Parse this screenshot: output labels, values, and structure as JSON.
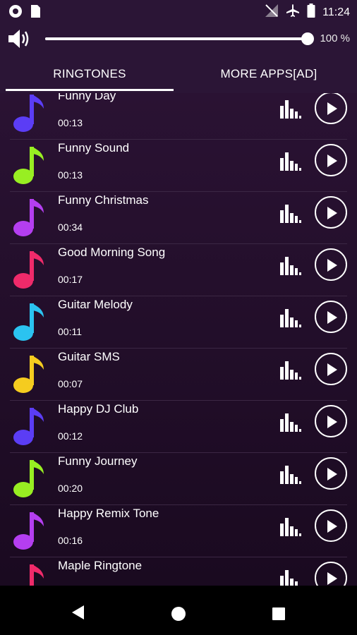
{
  "status_bar": {
    "time": "11:24",
    "left_icons": [
      "circle-icon",
      "sim-card-icon"
    ],
    "right_icons": [
      "no-signal-icon",
      "airplane-icon",
      "battery-icon"
    ]
  },
  "volume": {
    "icon": "speaker-icon",
    "level": 1.0,
    "percent_label": "100 %"
  },
  "tabs": [
    {
      "label": "RINGTONES",
      "active": true
    },
    {
      "label": "MORE APPS[AD]",
      "active": false
    }
  ],
  "ringtones": [
    {
      "title": "Funny Day",
      "duration": "00:13",
      "color": "#5b3df5"
    },
    {
      "title": "Funny Sound",
      "duration": "00:13",
      "color": "#98ee22"
    },
    {
      "title": "Funny Christmas",
      "duration": "00:34",
      "color": "#b43ef0"
    },
    {
      "title": "Good Morning Song",
      "duration": "00:17",
      "color": "#ef2a6a"
    },
    {
      "title": "Guitar Melody",
      "duration": "00:11",
      "color": "#2bc3f0"
    },
    {
      "title": "Guitar SMS",
      "duration": "00:07",
      "color": "#f5cc1f"
    },
    {
      "title": "Happy DJ Club",
      "duration": "00:12",
      "color": "#5b3df5"
    },
    {
      "title": "Funny Journey",
      "duration": "00:20",
      "color": "#98ee22"
    },
    {
      "title": "Happy Remix Tone",
      "duration": "00:16",
      "color": "#b43ef0"
    },
    {
      "title": "Maple Ringtone",
      "duration": "",
      "color": "#ef2a6a"
    }
  ],
  "row_icons": {
    "note": "music-note-icon",
    "bars": "equalizer-icon",
    "play": "play-icon"
  },
  "nav": [
    "back-icon",
    "home-icon",
    "recents-icon"
  ]
}
